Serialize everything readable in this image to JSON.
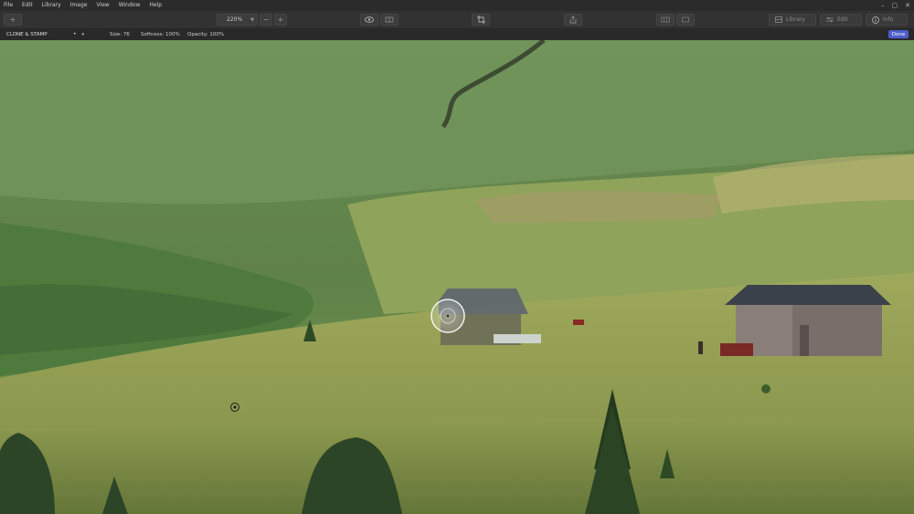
{
  "menu": [
    "File",
    "Edit",
    "Library",
    "Image",
    "View",
    "Window",
    "Help"
  ],
  "window_controls": [
    "–",
    "▢",
    "✕"
  ],
  "toolbar": {
    "zoom": "220%",
    "zoom_out": "−",
    "zoom_in": "+",
    "library_label": "Library",
    "edit_label": "Edit",
    "info_label": "Info"
  },
  "options_bar": {
    "tool_name": "CLONE & STAMP",
    "size": "Size: 76",
    "softness": "Softness: 100%",
    "opacity": "Opacity: 100%",
    "done_label": "Done"
  },
  "colors": {
    "accent": "#4c5dc9",
    "chrome_dark": "#2b2b2b",
    "toolbar": "#323232"
  }
}
